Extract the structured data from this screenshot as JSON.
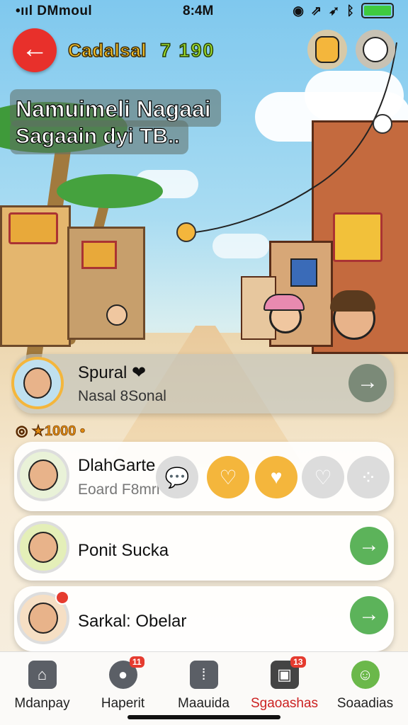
{
  "status_bar": {
    "carrier": "•ııl DMmoul",
    "time": "8:4M"
  },
  "header": {
    "game_name": "Cadalsal",
    "score": "7 190"
  },
  "caption": {
    "line1": "Namuimeli Nagaai",
    "line2": "Sagaain dyi TB.."
  },
  "coins": "◎ ★1000 •",
  "cards": [
    {
      "name": "Spural ❤",
      "subtitle": "Nasal 8Sonal",
      "action": "→"
    },
    {
      "name": "DlahGarte",
      "subtitle": "Eoard F8mrl",
      "extra": "8"
    },
    {
      "name": "Ponit Sucka",
      "action": "→"
    },
    {
      "name": "Sarkal: Obelar",
      "action": "→"
    }
  ],
  "icons": {
    "back": "arrow-left",
    "reactions": [
      "speech-bubble",
      "heart-bubble",
      "heart",
      "heart-hand",
      "dots-heart"
    ]
  },
  "nav": [
    {
      "label": "Mdanpay",
      "icon": "home-icon"
    },
    {
      "label": "Haperit",
      "icon": "chat-icon",
      "badge": "11"
    },
    {
      "label": "Maauida",
      "icon": "media-icon"
    },
    {
      "label": "Sgaoashas",
      "icon": "gift-icon",
      "badge": "13"
    },
    {
      "label": "Soaadias",
      "icon": "profile-icon"
    }
  ],
  "colors": {
    "accent_red": "#e8302b",
    "go_green": "#5cb35a",
    "reaction_yellow": "#f4b63c"
  }
}
